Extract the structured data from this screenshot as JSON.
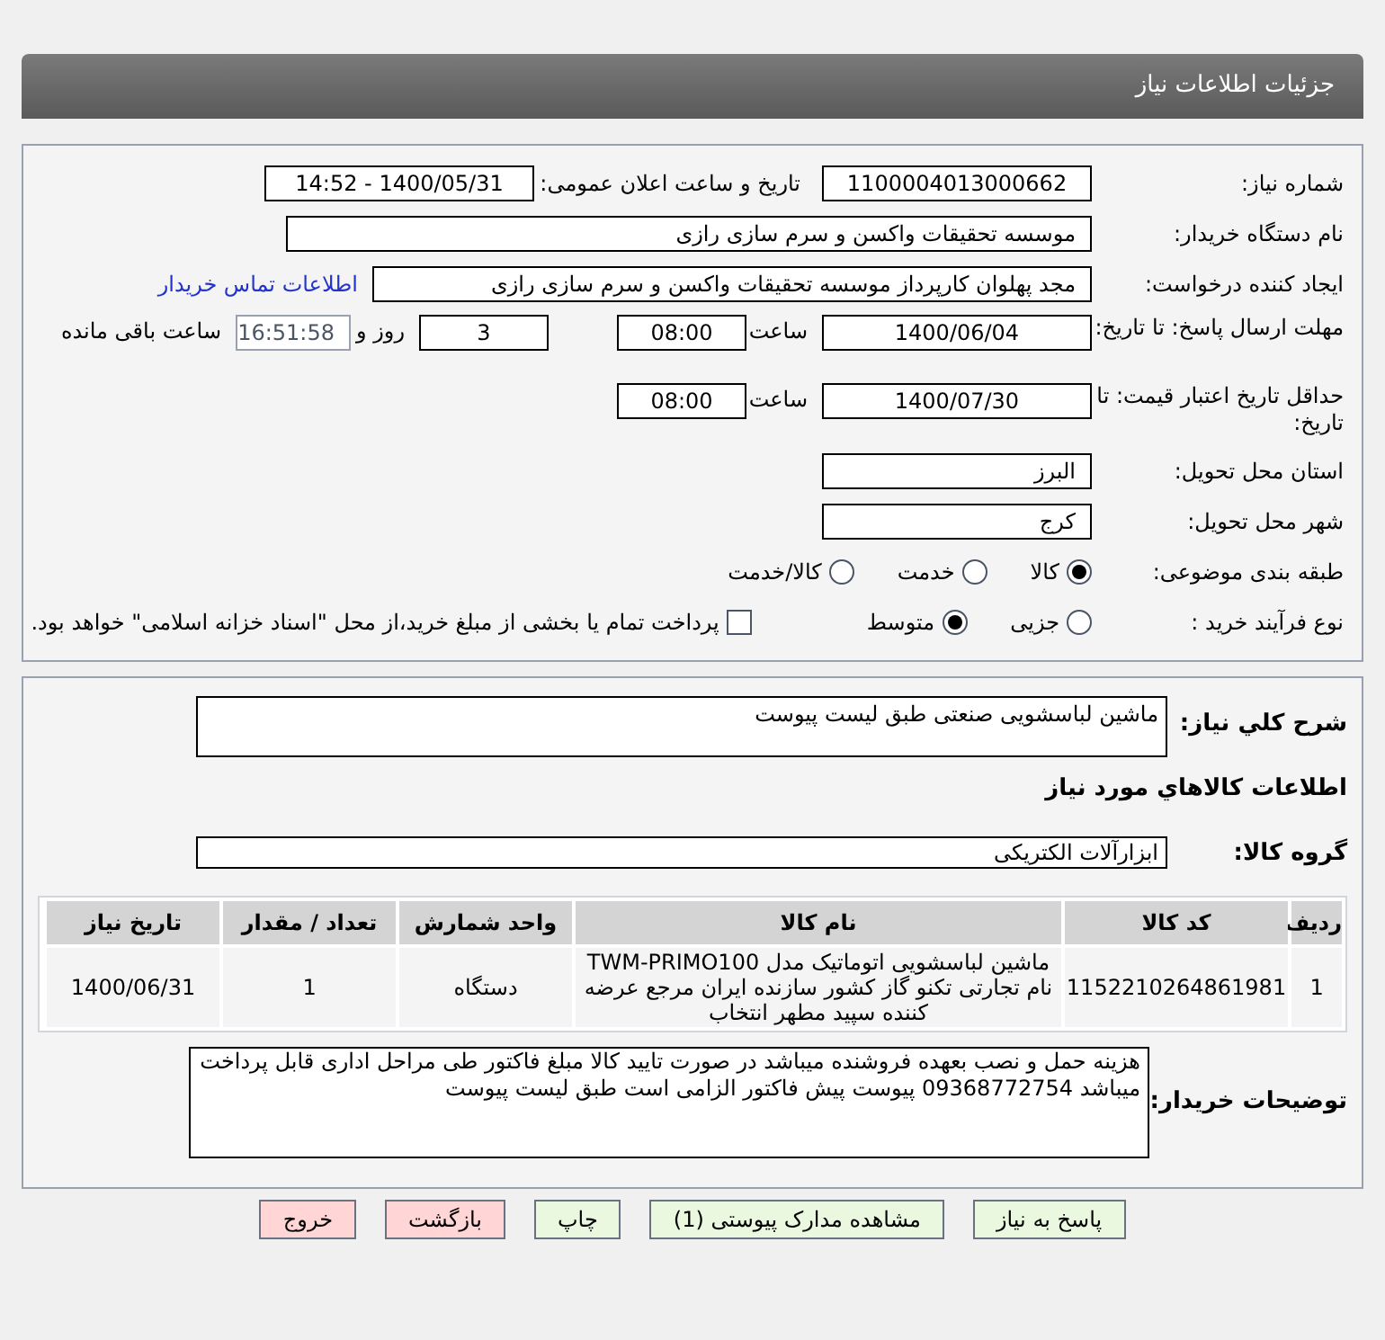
{
  "header": {
    "title": "جزئیات اطلاعات نیاز"
  },
  "details": {
    "need_number": {
      "label": "شماره نیاز:",
      "value": "1100004013000662"
    },
    "announce": {
      "label": "تاریخ و ساعت اعلان عمومی:",
      "value": "1400/05/31 - 14:52"
    },
    "buyer_org": {
      "label": "نام دستگاه خریدار:",
      "value": "موسسه تحقیقات واکسن و سرم سازی رازی"
    },
    "creator": {
      "label": "ایجاد کننده درخواست:",
      "value": "مجد پهلوان  کارپرداز موسسه تحقیقات واکسن و سرم سازی رازی",
      "link": "اطلاعات تماس خریدار"
    },
    "deadline": {
      "label": "مهلت ارسال پاسخ: تا تاریخ:",
      "date": "1400/06/04",
      "time_label": "ساعت",
      "time": "08:00",
      "days": "3",
      "days_label": "روز و",
      "remaining": "16:51:58",
      "remaining_label": "ساعت باقی مانده"
    },
    "validity": {
      "label": "حداقل تاریخ اعتبار قیمت: تا تاریخ:",
      "date": "1400/07/30",
      "time_label": "ساعت",
      "time": "08:00"
    },
    "province": {
      "label": "استان محل تحویل:",
      "value": "البرز"
    },
    "city": {
      "label": "شهر محل تحویل:",
      "value": "کرج"
    },
    "category": {
      "label": "طبقه بندی موضوعی:",
      "options": [
        {
          "label": "کالا",
          "selected": true
        },
        {
          "label": "خدمت",
          "selected": false
        },
        {
          "label": "کالا/خدمت",
          "selected": false
        }
      ]
    },
    "purchase_type": {
      "label": "نوع فرآیند خرید :",
      "options": [
        {
          "kind": "radio",
          "label": "جزیی",
          "selected": false
        },
        {
          "kind": "radio",
          "label": "متوسط",
          "selected": true
        },
        {
          "kind": "checkbox",
          "label": "پرداخت تمام یا بخشی از مبلغ خرید،از محل \"اسناد خزانه اسلامی\" خواهد بود.",
          "checked": false
        }
      ]
    }
  },
  "items": {
    "description": {
      "label": "شرح کلي نياز:",
      "value": "ماشین لباسشویی صنعتی طبق لیست پیوست"
    },
    "heading": "اطلاعات كالاهاي مورد نياز",
    "group": {
      "label": "گروه کالا:",
      "value": "ابزارآلات الکتریکی"
    },
    "table": {
      "columns": [
        "ردیف",
        "کد کالا",
        "نام کالا",
        "واحد شمارش",
        "تعداد / مقدار",
        "تاریخ نیاز"
      ],
      "rows": [
        [
          "1",
          "1152210264861981",
          "ماشین لباسشویی اتوماتیک مدل TWM-PRIMO100 نام تجارتی تکنو گاز کشور سازنده ایران مرجع عرضه کننده سپید مطهر انتخاب",
          "دستگاه",
          "1",
          "1400/06/31"
        ]
      ]
    },
    "notes": {
      "label": "توضیحات خریدار:",
      "value": "هزینه حمل و نصب بعهده فروشنده میباشد در صورت تایید کالا مبلغ فاکتور طی مراحل اداری قابل پرداخت میباشد 09368772754 پیوست پیش فاکتور الزامی است  طبق لیست پیوست"
    }
  },
  "buttons": [
    {
      "label": "پاسخ به نیاز",
      "kind": "normal"
    },
    {
      "label": "مشاهده مدارک پیوستی (1)",
      "kind": "normal"
    },
    {
      "label": "چاپ",
      "kind": "normal"
    },
    {
      "label": "بازگشت",
      "kind": "danger"
    },
    {
      "label": "خروج",
      "kind": "danger"
    }
  ]
}
